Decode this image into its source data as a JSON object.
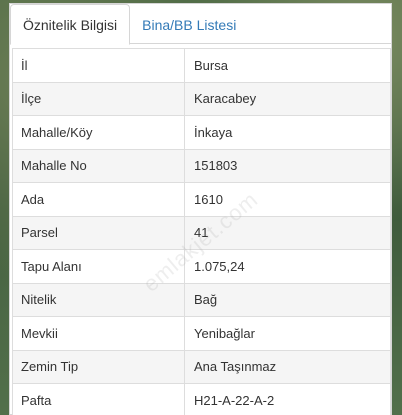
{
  "tabs": [
    {
      "label": "Öznitelik Bilgisi",
      "active": true
    },
    {
      "label": "Bina/BB Listesi",
      "active": false
    }
  ],
  "rows": [
    {
      "key": "İl",
      "value": "Bursa"
    },
    {
      "key": "İlçe",
      "value": "Karacabey"
    },
    {
      "key": "Mahalle/Köy",
      "value": "İnkaya"
    },
    {
      "key": "Mahalle No",
      "value": "151803"
    },
    {
      "key": "Ada",
      "value": "1610"
    },
    {
      "key": "Parsel",
      "value": "41"
    },
    {
      "key": "Tapu Alanı",
      "value": "1.075,24"
    },
    {
      "key": "Nitelik",
      "value": "Bağ"
    },
    {
      "key": "Mevkii",
      "value": "Yenibağlar"
    },
    {
      "key": "Zemin Tip",
      "value": "Ana Taşınmaz"
    },
    {
      "key": "Pafta",
      "value": "H21-A-22-A-2"
    }
  ],
  "watermark": "emlakjet.com",
  "colors": {
    "tab_link": "#337ab7",
    "text": "#333333",
    "stripe": "#f5f5f5",
    "border": "#dddddd"
  }
}
